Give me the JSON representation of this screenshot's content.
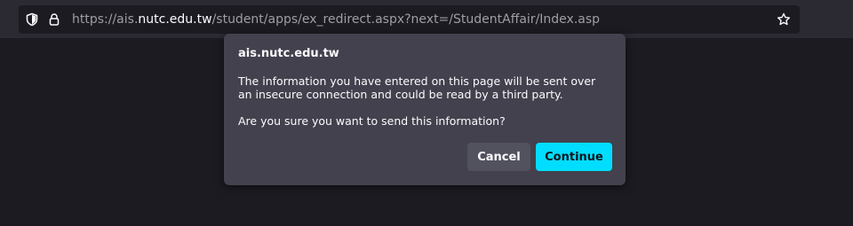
{
  "browser": {
    "url_prefix": "https://ais.",
    "url_host": "nutc.edu.tw",
    "url_path": "/student/apps/ex_redirect.aspx?next=/StudentAffair/Index.asp",
    "icons": {
      "site_info": "shield-icon",
      "security": "lock-icon",
      "bookmark": "star-icon"
    }
  },
  "dialog": {
    "title": "ais.nutc.edu.tw",
    "message": "The information you have entered on this page will be sent over an insecure connection and could be read by a third party.",
    "question": "Are you sure you want to send this information?",
    "cancel_label": "Cancel",
    "continue_label": "Continue"
  },
  "colors": {
    "page_background": "#1c1b22",
    "toolbar_background": "#2b2a33",
    "dialog_background": "#42414d",
    "primary_button": "#00ddff",
    "secondary_button": "#52515e"
  }
}
